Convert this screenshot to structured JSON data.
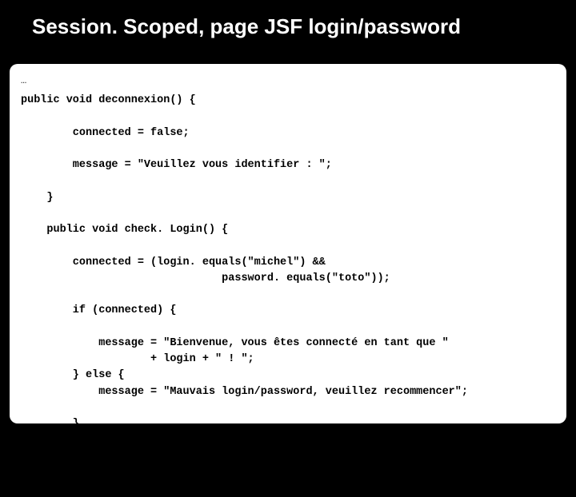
{
  "slide": {
    "title": "Session. Scoped, page JSF login/password",
    "ellipsis": "…",
    "code": "public void deconnexion() {\n\n        connected = false;\n\n        message = \"Veuillez vous identifier : \";\n\n    }\n\n    public void check. Login() {\n\n        connected = (login. equals(\"michel\") &&\n                               password. equals(\"toto\"));\n\n        if (connected) {\n\n            message = \"Bienvenue, vous êtes connecté en tant que \"\n                    + login + \" ! \";\n        } else {\n            message = \"Mauvais login/password, veuillez recommencer\";\n\n        }\n\n    }\n\n}"
  }
}
